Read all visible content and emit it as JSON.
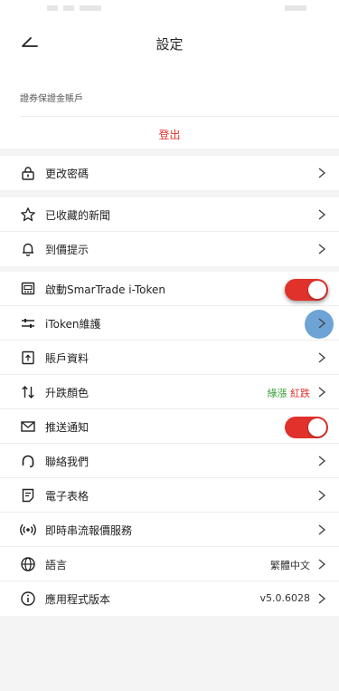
{
  "nav": {
    "title": "設定",
    "back_icon": "back-arrow-icon"
  },
  "account": {
    "label": "證券保證金賬戶",
    "logout": "登出"
  },
  "colors": {
    "accent_red": "#e0312b",
    "rise_green": "#3a9d35",
    "highlight_blue": "#6ea3d6"
  },
  "groups": [
    {
      "items": [
        {
          "label": "更改密碼",
          "icon": "lock-icon"
        }
      ]
    },
    {
      "items": [
        {
          "label": "已收藏的新聞",
          "icon": "star-icon"
        },
        {
          "label": "到價提示",
          "icon": "bell-icon"
        }
      ]
    },
    {
      "items": [
        {
          "label": "啟動SmarTrade i-Token",
          "icon": "token-icon",
          "toggle": "on"
        },
        {
          "label": "iToken維護",
          "icon": "sliders-icon"
        },
        {
          "label": "賬戶資料",
          "icon": "account-doc-icon"
        },
        {
          "label": "升跌顏色",
          "icon": "up-down-arrows-icon",
          "value_green": "綠漲",
          "value_red": "紅跌"
        },
        {
          "label": "推送通知",
          "icon": "mail-icon",
          "toggle": "on"
        },
        {
          "label": "聯絡我們",
          "icon": "headset-icon"
        },
        {
          "label": "電子表格",
          "icon": "form-icon"
        },
        {
          "label": "即時串流報價服務",
          "icon": "broadcast-icon"
        },
        {
          "label": "語言",
          "icon": "globe-icon",
          "value": "繁體中文"
        },
        {
          "label": "應用程式版本",
          "icon": "info-icon",
          "value": "v5.0.6028"
        }
      ]
    }
  ]
}
